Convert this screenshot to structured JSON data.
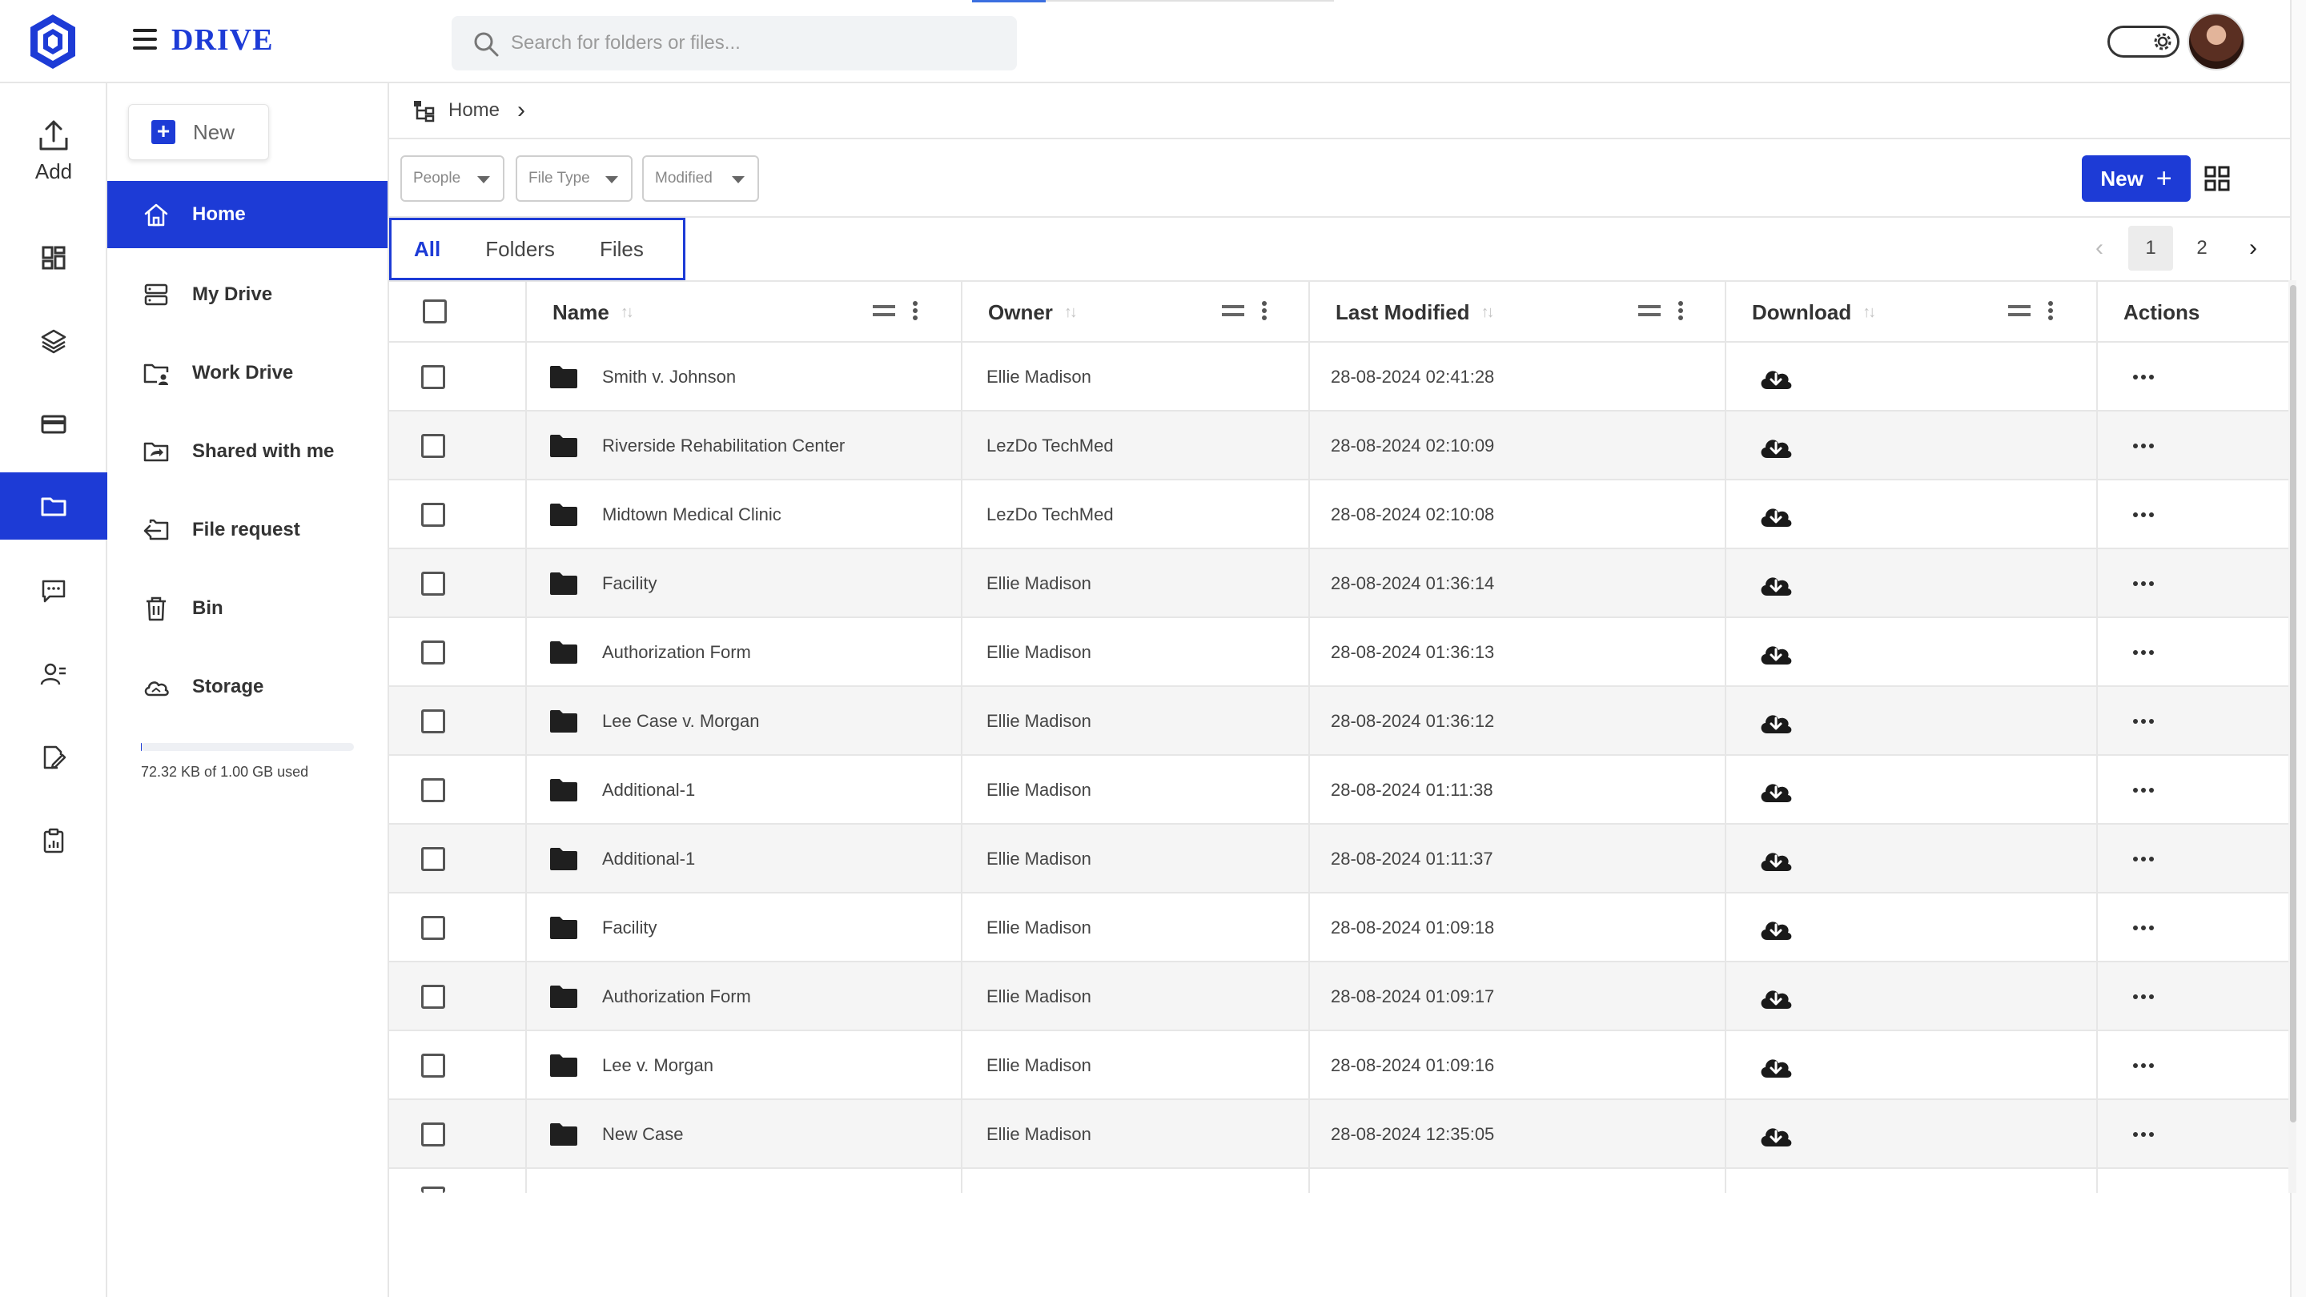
{
  "app": {
    "brand": "DRIVE"
  },
  "search": {
    "placeholder": "Search for folders or files..."
  },
  "rail": {
    "add_label": "Add",
    "items": [
      {
        "icon": "dashboard-icon"
      },
      {
        "icon": "layers-icon"
      },
      {
        "icon": "card-icon"
      },
      {
        "icon": "folder-icon",
        "active": true
      },
      {
        "icon": "chat-icon"
      },
      {
        "icon": "contacts-icon"
      },
      {
        "icon": "edit-document-icon"
      },
      {
        "icon": "clipboard-icon"
      }
    ]
  },
  "nav": {
    "new_label": "New",
    "items": [
      {
        "label": "Home",
        "icon": "home-icon",
        "active": true
      },
      {
        "label": "My Drive",
        "icon": "drive-icon"
      },
      {
        "label": "Work Drive",
        "icon": "work-folder-icon"
      },
      {
        "label": "Shared with me",
        "icon": "shared-folder-icon"
      },
      {
        "label": "File request",
        "icon": "file-request-icon"
      },
      {
        "label": "Bin",
        "icon": "bin-icon"
      },
      {
        "label": "Storage",
        "icon": "cloud-icon"
      }
    ],
    "storage_text": "72.32 KB of 1.00 GB used",
    "storage_used_fraction": 0.0001
  },
  "breadcrumb": {
    "home": "Home"
  },
  "filters": {
    "people": "People",
    "file_type": "File Type",
    "modified": "Modified"
  },
  "toolbar": {
    "new_label": "New"
  },
  "tabs": [
    "All",
    "Folders",
    "Files"
  ],
  "pagination": {
    "pages": [
      "1",
      "2"
    ],
    "current": "1"
  },
  "table": {
    "headers": {
      "name": "Name",
      "owner": "Owner",
      "last_modified": "Last Modified",
      "download": "Download",
      "actions": "Actions"
    },
    "rows": [
      {
        "name": "Smith v. Johnson",
        "owner": "Ellie Madison",
        "modified": "28-08-2024 02:41:28"
      },
      {
        "name": "Riverside Rehabilitation Center",
        "owner": "LezDo TechMed",
        "modified": "28-08-2024 02:10:09"
      },
      {
        "name": "Midtown Medical Clinic",
        "owner": "LezDo TechMed",
        "modified": "28-08-2024 02:10:08"
      },
      {
        "name": "Facility",
        "owner": "Ellie Madison",
        "modified": "28-08-2024 01:36:14"
      },
      {
        "name": "Authorization Form",
        "owner": "Ellie Madison",
        "modified": "28-08-2024 01:36:13"
      },
      {
        "name": "Lee Case v. Morgan",
        "owner": "Ellie Madison",
        "modified": "28-08-2024 01:36:12"
      },
      {
        "name": "Additional-1",
        "owner": "Ellie Madison",
        "modified": "28-08-2024 01:11:38"
      },
      {
        "name": "Additional-1",
        "owner": "Ellie Madison",
        "modified": "28-08-2024 01:11:37"
      },
      {
        "name": "Facility",
        "owner": "Ellie Madison",
        "modified": "28-08-2024 01:09:18"
      },
      {
        "name": "Authorization Form",
        "owner": "Ellie Madison",
        "modified": "28-08-2024 01:09:17"
      },
      {
        "name": "Lee v. Morgan",
        "owner": "Ellie Madison",
        "modified": "28-08-2024 01:09:16"
      },
      {
        "name": "New Case",
        "owner": "Ellie Madison",
        "modified": "28-08-2024 12:35:05"
      }
    ]
  },
  "colors": {
    "primary": "#1d3bd6",
    "row_alt": "#f5f5f5",
    "border": "#e6e6e6"
  }
}
